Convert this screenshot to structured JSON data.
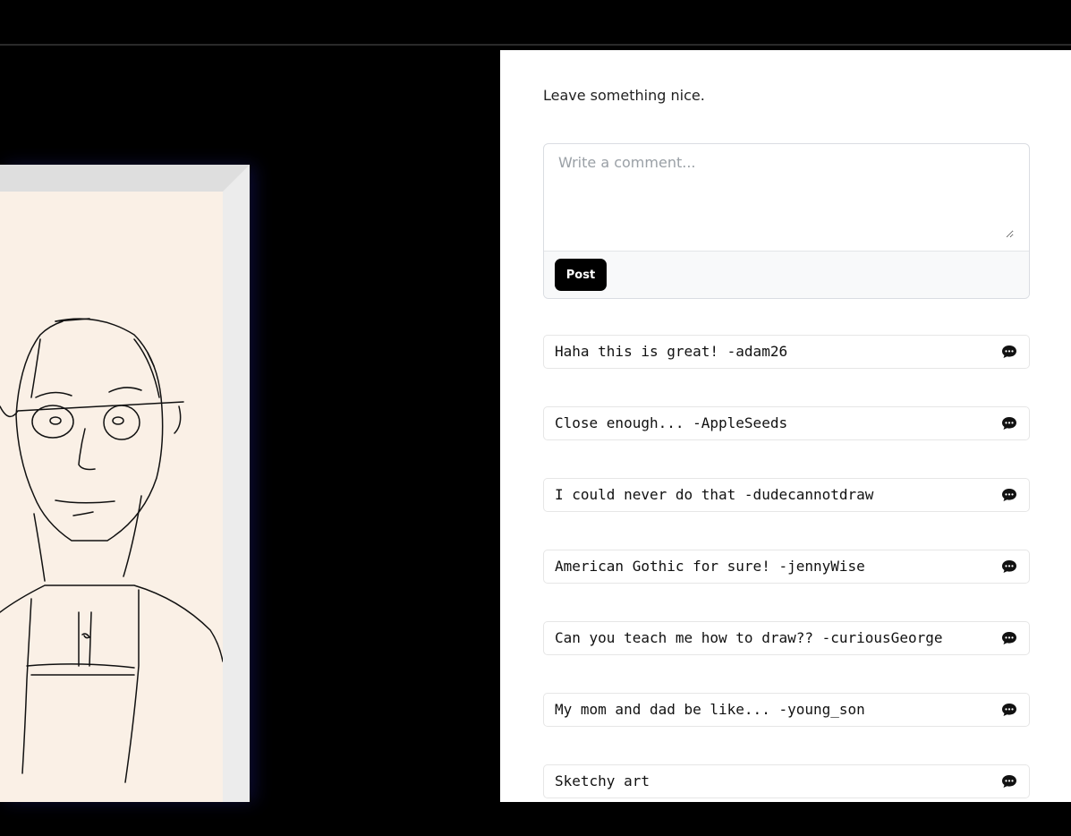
{
  "comments_panel": {
    "prompt": "Leave something nice.",
    "composer": {
      "placeholder": "Write a comment...",
      "value": "",
      "post_label": "Post"
    },
    "comments": [
      {
        "text": "Haha this is great! -adam26",
        "icon": "comment-bubble-icon"
      },
      {
        "text": "Close enough... -AppleSeeds",
        "icon": "comment-bubble-icon"
      },
      {
        "text": "I could never do that -dudecannotdraw",
        "icon": "comment-bubble-icon"
      },
      {
        "text": "American Gothic for sure! -jennyWise",
        "icon": "comment-bubble-icon"
      },
      {
        "text": "Can you teach me how to draw?? -curiousGeorge",
        "icon": "comment-bubble-icon"
      },
      {
        "text": "My mom and dad be like... -young_son",
        "icon": "comment-bubble-icon"
      },
      {
        "text": "Sketchy art",
        "icon": "comment-bubble-icon"
      }
    ]
  },
  "colors": {
    "background": "#000000",
    "panel": "#ffffff",
    "artwork_paper": "#faf0e6",
    "frame": "#e6e6e6",
    "post_button": "#000000"
  }
}
